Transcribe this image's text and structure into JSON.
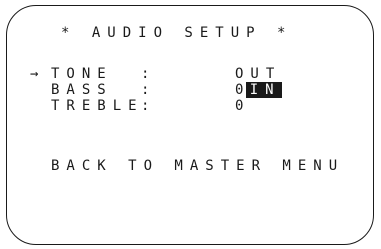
{
  "title": "* AUDIO SETUP *",
  "cursor": "→",
  "rows": [
    {
      "label": "TONE",
      "colon": ":",
      "value_selected": "IN",
      "value_other": "OUT"
    },
    {
      "label": "BASS",
      "colon": ":",
      "value": "0"
    },
    {
      "label": "TREBLE",
      "colon": ":",
      "value": "0"
    }
  ],
  "footer": "BACK TO MASTER MENU"
}
